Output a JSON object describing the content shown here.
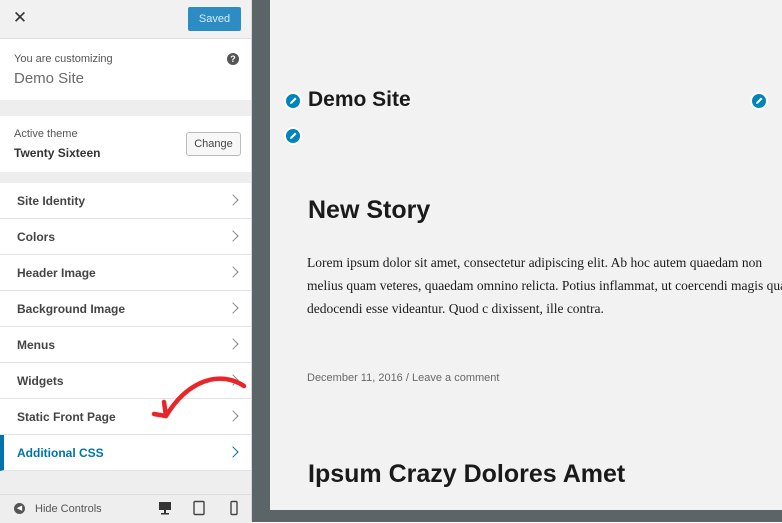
{
  "sidebar": {
    "close_icon": "✕",
    "saved_label": "Saved",
    "customizing_label": "You are customizing",
    "site_name": "Demo Site",
    "help_icon": "?",
    "active_theme_label": "Active theme",
    "active_theme_name": "Twenty Sixteen",
    "change_label": "Change",
    "panels": [
      {
        "label": "Site Identity"
      },
      {
        "label": "Colors"
      },
      {
        "label": "Header Image"
      },
      {
        "label": "Background Image"
      },
      {
        "label": "Menus"
      },
      {
        "label": "Widgets"
      },
      {
        "label": "Static Front Page"
      },
      {
        "label": "Additional CSS",
        "active": true
      }
    ],
    "footer": {
      "hide_controls_label": "Hide Controls",
      "devices": [
        "desktop-icon",
        "tablet-icon",
        "mobile-icon"
      ]
    }
  },
  "preview": {
    "site_title": "Demo Site",
    "post_title": "New Story",
    "post_body": "Lorem ipsum dolor sit amet, consectetur adipiscing elit. Ab hoc autem quaedam non melius quam veteres, quaedam omnino relicta. Potius inflammat, ut coercendi magis quam dedocendi esse videantur. Quod c dixissent, ille contra.",
    "post_date": "December 11, 2016",
    "meta_separator": "/",
    "leave_comment": "Leave a comment",
    "second_post_title": "Ipsum Crazy Dolores Amet"
  },
  "colors": {
    "accent": "#0073aa",
    "saved_button": "#2e8cc4",
    "edit_shortcut": "#0085ba",
    "preview_frame": "#5b6466",
    "annotation_arrow": "#e8262a"
  }
}
